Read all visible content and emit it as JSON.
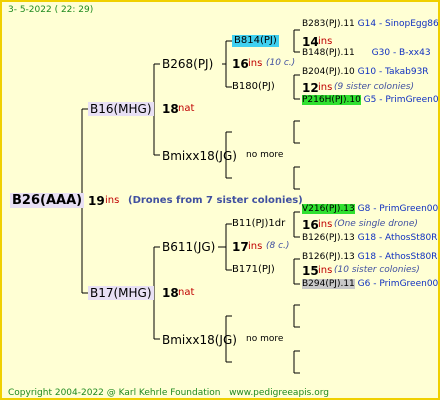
{
  "header": {
    "date": "3-  5-2022 ( 22: 29)"
  },
  "footer": {
    "copyright": "Copyright 2004-2022 @ Karl Kehrle Foundation",
    "site": "www.pedigreeapis.org"
  },
  "root": {
    "name": "B26(AAA)",
    "num": "19",
    "ins": "ins",
    "note": "(Drones from 7 sister colonies)"
  },
  "father": {
    "name": "B16(MHG)",
    "num": "18",
    "suffix": "nat"
  },
  "mother": {
    "name": "B17(MHG)",
    "num": "18",
    "suffix": "nat"
  },
  "ff": {
    "name": "B268(PJ)",
    "num": "16",
    "ins": "ins",
    "note": "(10 c.)"
  },
  "fm": {
    "name": "Bmixx18(JG)",
    "nomore": "no more"
  },
  "mf": {
    "name": "B611(JG)",
    "num": "17",
    "ins": "ins",
    "note": "(8 c.)"
  },
  "mm": {
    "name": "Bmixx18(JG)",
    "nomore": "no more"
  },
  "fff": {
    "name": "B814(PJ)",
    "num": "14",
    "ins": "ins"
  },
  "ffm": {
    "name": "B180(PJ)",
    "num": "12",
    "ins": "ins",
    "note": "(9 sister colonies)"
  },
  "mff": {
    "name": "B11(PJ)1dr",
    "num": "16",
    "ins": "ins",
    "note": "(One single drone)"
  },
  "mfm": {
    "name": "B171(PJ)",
    "num": "15",
    "ins": "ins",
    "note": "(10 sister colonies)"
  },
  "g4": [
    {
      "name": "B283(PJ).11",
      "info": "G14 - SinopEgg86R"
    },
    {
      "name": "B148(PJ).11",
      "info": "G30 - B-xx43"
    },
    {
      "name": "B204(PJ).10",
      "info": "G10 - Takab93R"
    },
    {
      "name": "P216H(PJ).10",
      "info": "G5 - PrimGreen00"
    },
    {
      "name": "V216(PJ).13",
      "info": "G8 - PrimGreen00"
    },
    {
      "name": "B126(PJ).13",
      "info": "G18 - AthosSt80R"
    },
    {
      "name": "B126(PJ).13",
      "info": "G18 - AthosSt80R"
    },
    {
      "name": "B294(PJ).11",
      "info": "G6 - PrimGreen00"
    }
  ]
}
